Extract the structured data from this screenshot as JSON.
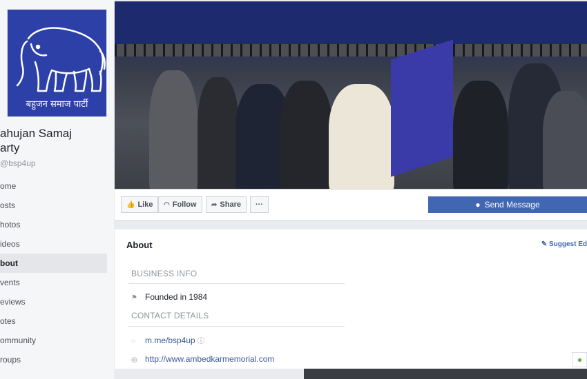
{
  "sidebar": {
    "logo_text": "बहुजन समाज पार्टी",
    "page_name_line1": "ahujan Samaj",
    "page_name_line2": "arty",
    "handle": "bsp4up",
    "items": [
      {
        "label": "ome"
      },
      {
        "label": "osts"
      },
      {
        "label": "hotos"
      },
      {
        "label": "ideos"
      },
      {
        "label": "bout"
      },
      {
        "label": "vents"
      },
      {
        "label": "eviews"
      },
      {
        "label": "otes"
      },
      {
        "label": "ommunity"
      },
      {
        "label": "roups"
      }
    ]
  },
  "actions": {
    "like": "Like",
    "follow": "Follow",
    "share": "Share",
    "more": "···",
    "send_message": "Send Message"
  },
  "about": {
    "title": "About",
    "suggest": "Suggest Ed",
    "business_info": "BUSINESS INFO",
    "founded": "Founded in 1984",
    "contact_details": "CONTACT DETAILS",
    "messenger": "m.me/bsp4up",
    "website": "http://www.ambedkarmemorial.com"
  },
  "colors": {
    "brand_blue": "#4267b2",
    "logo_blue": "#2d40a8",
    "link": "#385898"
  }
}
